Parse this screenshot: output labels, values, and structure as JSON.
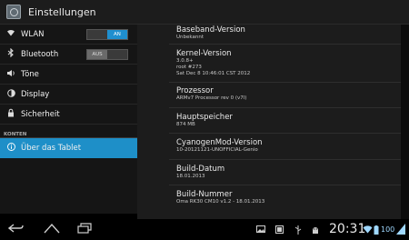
{
  "actionbar": {
    "title": "Einstellungen"
  },
  "sidebar": {
    "items": [
      {
        "label": "WLAN",
        "icon": "wifi-icon",
        "toggle": {
          "left": "",
          "right": "AN",
          "state": "on"
        }
      },
      {
        "label": "Bluetooth",
        "icon": "bluetooth-icon",
        "toggle": {
          "left": "AUS",
          "right": "",
          "state": "off"
        }
      },
      {
        "label": "Töne",
        "icon": "volume-icon"
      },
      {
        "label": "Display",
        "icon": "brightness-icon"
      },
      {
        "label": "Sicherheit",
        "icon": "lock-icon"
      }
    ],
    "section": "KONTEN",
    "selected": {
      "label": "Über das Tablet",
      "icon": "info-icon"
    }
  },
  "info": [
    {
      "title": "Baseband-Version",
      "lines": [
        "Unbekannt"
      ]
    },
    {
      "title": "Kernel-Version",
      "lines": [
        "3.0.8+",
        "root #273",
        "Sat Dec 8 10:46:01 CST 2012"
      ]
    },
    {
      "title": "Prozessor",
      "lines": [
        "ARMv7 Processor rev 0 (v7l)"
      ]
    },
    {
      "title": "Hauptspeicher",
      "lines": [
        "874 MB"
      ]
    },
    {
      "title": "CyanogenMod-Version",
      "lines": [
        "10-20121121-UNOFFICIAL-Genio"
      ]
    },
    {
      "title": "Build-Datum",
      "lines": [
        "18.01.2013"
      ]
    },
    {
      "title": "Build-Nummer",
      "lines": [
        "Oma RK30 CM10 v1.2 - 18.01.2013"
      ]
    }
  ],
  "statusbar": {
    "time": "20:31",
    "battery": "100"
  },
  "colors": {
    "accent": "#1e8fc8",
    "toggle_on": "#1f8fcf"
  }
}
